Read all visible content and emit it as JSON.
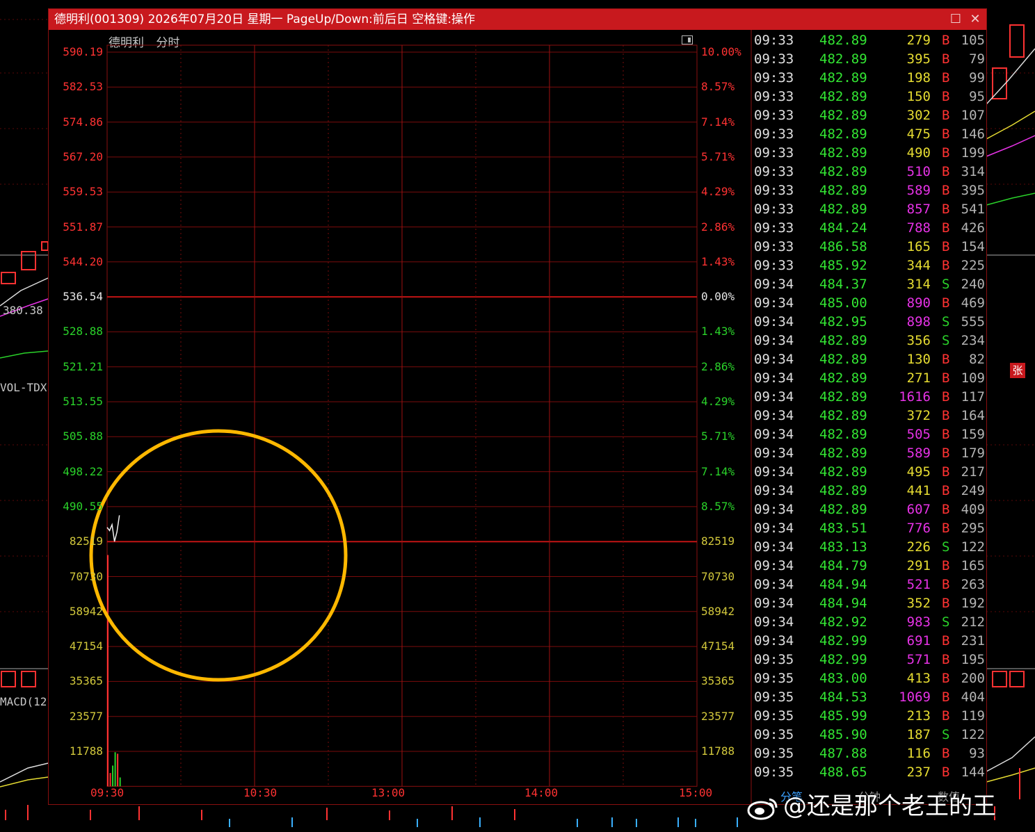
{
  "window": {
    "title": "德明利(001309) 2026年07月20日 星期一 PageUp/Down:前后日 空格键:操作",
    "maximize_glyph": "☐",
    "close_glyph": "✕"
  },
  "chart_header": {
    "name": "德明利",
    "mode": "分时"
  },
  "chart_data": {
    "type": "line",
    "title": "",
    "price_axis": {
      "labels": [
        "590.19",
        "582.53",
        "574.86",
        "567.20",
        "559.53",
        "551.87",
        "544.20",
        "536.54",
        "528.88",
        "521.21",
        "513.55",
        "505.88",
        "498.22",
        "490.55"
      ],
      "pct_labels": [
        "10.00%",
        "8.57%",
        "7.14%",
        "5.71%",
        "4.29%",
        "2.86%",
        "1.43%",
        "0.00%",
        "1.43%",
        "2.86%",
        "4.29%",
        "5.71%",
        "7.14%",
        "8.57%"
      ],
      "prev_close": 536.54,
      "ylim": [
        490.55,
        590.19
      ]
    },
    "volume_axis": {
      "labels": [
        "82519",
        "70730",
        "58942",
        "47154",
        "35365",
        "23577",
        "11788"
      ],
      "ylim": [
        0,
        82519
      ]
    },
    "time_labels": [
      "09:30",
      "10:30",
      "13:00",
      "14:00",
      "15:00"
    ],
    "price_series": {
      "x": [
        "09:30",
        "09:31",
        "09:32",
        "09:33",
        "09:34",
        "09:35"
      ],
      "values": [
        486.0,
        485.3,
        486.6,
        482.9,
        485.0,
        488.65
      ]
    },
    "volume_series": {
      "x": [
        "09:30",
        "09:31",
        "09:32",
        "09:33",
        "09:34",
        "09:35"
      ],
      "values": [
        78000,
        4500,
        7000,
        11500,
        11000,
        3000
      ],
      "colors": [
        "#ff3232",
        "#ff3232",
        "#2ad22a",
        "#2ad22a",
        "#ff3232",
        "#2ad22a"
      ]
    }
  },
  "trades": [
    {
      "time": "09:33",
      "price": "482.89",
      "vol": "279",
      "vol_color": "y",
      "bs": "B",
      "count": "105"
    },
    {
      "time": "09:33",
      "price": "482.89",
      "vol": "395",
      "vol_color": "y",
      "bs": "B",
      "count": "79"
    },
    {
      "time": "09:33",
      "price": "482.89",
      "vol": "198",
      "vol_color": "y",
      "bs": "B",
      "count": "99"
    },
    {
      "time": "09:33",
      "price": "482.89",
      "vol": "150",
      "vol_color": "y",
      "bs": "B",
      "count": "95"
    },
    {
      "time": "09:33",
      "price": "482.89",
      "vol": "302",
      "vol_color": "y",
      "bs": "B",
      "count": "107"
    },
    {
      "time": "09:33",
      "price": "482.89",
      "vol": "475",
      "vol_color": "y",
      "bs": "B",
      "count": "146"
    },
    {
      "time": "09:33",
      "price": "482.89",
      "vol": "490",
      "vol_color": "y",
      "bs": "B",
      "count": "199"
    },
    {
      "time": "09:33",
      "price": "482.89",
      "vol": "510",
      "vol_color": "m",
      "bs": "B",
      "count": "314"
    },
    {
      "time": "09:33",
      "price": "482.89",
      "vol": "589",
      "vol_color": "m",
      "bs": "B",
      "count": "395"
    },
    {
      "time": "09:33",
      "price": "482.89",
      "vol": "857",
      "vol_color": "m",
      "bs": "B",
      "count": "541"
    },
    {
      "time": "09:33",
      "price": "484.24",
      "vol": "788",
      "vol_color": "m",
      "bs": "B",
      "count": "426"
    },
    {
      "time": "09:33",
      "price": "486.58",
      "vol": "165",
      "vol_color": "y",
      "bs": "B",
      "count": "154"
    },
    {
      "time": "09:33",
      "price": "485.92",
      "vol": "344",
      "vol_color": "y",
      "bs": "B",
      "count": "225"
    },
    {
      "time": "09:34",
      "price": "484.37",
      "vol": "314",
      "vol_color": "y",
      "bs": "S",
      "count": "240"
    },
    {
      "time": "09:34",
      "price": "485.00",
      "vol": "890",
      "vol_color": "m",
      "bs": "B",
      "count": "469"
    },
    {
      "time": "09:34",
      "price": "482.95",
      "vol": "898",
      "vol_color": "m",
      "bs": "S",
      "count": "555"
    },
    {
      "time": "09:34",
      "price": "482.89",
      "vol": "356",
      "vol_color": "y",
      "bs": "S",
      "count": "234"
    },
    {
      "time": "09:34",
      "price": "482.89",
      "vol": "130",
      "vol_color": "y",
      "bs": "B",
      "count": "82"
    },
    {
      "time": "09:34",
      "price": "482.89",
      "vol": "271",
      "vol_color": "y",
      "bs": "B",
      "count": "109"
    },
    {
      "time": "09:34",
      "price": "482.89",
      "vol": "1616",
      "vol_color": "m",
      "bs": "B",
      "count": "117"
    },
    {
      "time": "09:34",
      "price": "482.89",
      "vol": "372",
      "vol_color": "y",
      "bs": "B",
      "count": "164"
    },
    {
      "time": "09:34",
      "price": "482.89",
      "vol": "505",
      "vol_color": "m",
      "bs": "B",
      "count": "159"
    },
    {
      "time": "09:34",
      "price": "482.89",
      "vol": "589",
      "vol_color": "m",
      "bs": "B",
      "count": "179"
    },
    {
      "time": "09:34",
      "price": "482.89",
      "vol": "495",
      "vol_color": "y",
      "bs": "B",
      "count": "217"
    },
    {
      "time": "09:34",
      "price": "482.89",
      "vol": "441",
      "vol_color": "y",
      "bs": "B",
      "count": "249"
    },
    {
      "time": "09:34",
      "price": "482.89",
      "vol": "607",
      "vol_color": "m",
      "bs": "B",
      "count": "409"
    },
    {
      "time": "09:34",
      "price": "483.51",
      "vol": "776",
      "vol_color": "m",
      "bs": "B",
      "count": "295"
    },
    {
      "time": "09:34",
      "price": "483.13",
      "vol": "226",
      "vol_color": "y",
      "bs": "S",
      "count": "122"
    },
    {
      "time": "09:34",
      "price": "484.79",
      "vol": "291",
      "vol_color": "y",
      "bs": "B",
      "count": "165"
    },
    {
      "time": "09:34",
      "price": "484.94",
      "vol": "521",
      "vol_color": "m",
      "bs": "B",
      "count": "263"
    },
    {
      "time": "09:34",
      "price": "484.94",
      "vol": "352",
      "vol_color": "y",
      "bs": "B",
      "count": "192"
    },
    {
      "time": "09:34",
      "price": "482.92",
      "vol": "983",
      "vol_color": "m",
      "bs": "S",
      "count": "212"
    },
    {
      "time": "09:34",
      "price": "482.99",
      "vol": "691",
      "vol_color": "m",
      "bs": "B",
      "count": "231"
    },
    {
      "time": "09:35",
      "price": "482.99",
      "vol": "571",
      "vol_color": "m",
      "bs": "B",
      "count": "195"
    },
    {
      "time": "09:35",
      "price": "483.00",
      "vol": "413",
      "vol_color": "y",
      "bs": "B",
      "count": "200"
    },
    {
      "time": "09:35",
      "price": "484.53",
      "vol": "1069",
      "vol_color": "m",
      "bs": "B",
      "count": "404"
    },
    {
      "time": "09:35",
      "price": "485.99",
      "vol": "213",
      "vol_color": "y",
      "bs": "B",
      "count": "119"
    },
    {
      "time": "09:35",
      "price": "485.90",
      "vol": "187",
      "vol_color": "y",
      "bs": "S",
      "count": "122"
    },
    {
      "time": "09:35",
      "price": "487.88",
      "vol": "116",
      "vol_color": "y",
      "bs": "B",
      "count": "93"
    },
    {
      "time": "09:35",
      "price": "488.65",
      "vol": "237",
      "vol_color": "y",
      "bs": "B",
      "count": "144"
    }
  ],
  "tabs": [
    {
      "label": "分笔",
      "active": true
    },
    {
      "label": "分钟",
      "active": false
    },
    {
      "label": "数值",
      "active": false
    }
  ],
  "background": {
    "left_price_label": "380.38",
    "vol_indicator": "VOL-TDX",
    "macd_indicator": "MACD(12",
    "zhang_badge": "张"
  },
  "watermark": {
    "text": "@还是那个老王的王",
    "icon": "weibo-icon"
  },
  "colors": {
    "titlebar": "#c8191e",
    "grid": "#8a1010",
    "up": "#ff3232",
    "down": "#2ad22a",
    "highlight_circle": "#ffb800"
  }
}
